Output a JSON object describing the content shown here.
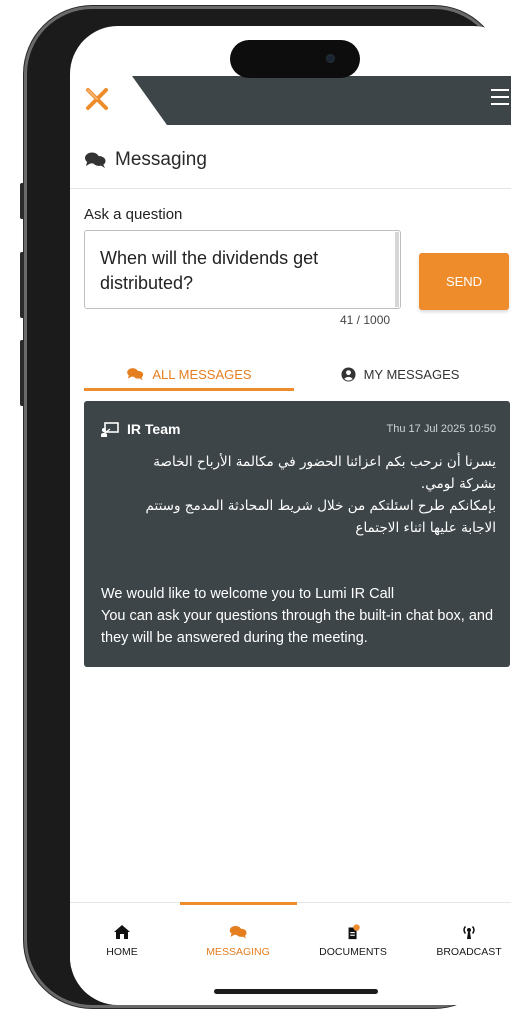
{
  "header": {
    "logo_icon": "x-logo-icon",
    "menu_icon": "hamburger-icon",
    "band_color": "#3d4548",
    "accent": "#ee8c2b"
  },
  "messaging": {
    "title": "Messaging",
    "title_icon": "chat-bubbles-icon",
    "ask_label": "Ask a question",
    "question_value": "When will the dividends get distributed?",
    "send_label": "SEND",
    "counter": "41 / 1000"
  },
  "tabs": [
    {
      "label": "ALL MESSAGES",
      "icon": "chat-bubbles-icon",
      "active": true
    },
    {
      "label": "MY MESSAGES",
      "icon": "user-circle-icon",
      "active": false
    }
  ],
  "message": {
    "sender": "IR Team",
    "sender_icon": "presenter-icon",
    "timestamp": "Thu 17 Jul 2025 10:50",
    "arabic_text": "يسرنا أن نرحب بكم اعزائنا الحضور في مكالمة الأرباح الخاصة\nبشركة لومي.\nبإمكانكم طرح اسئلتكم  من خلال شريط المحادثة المدمج وستتم\nالاجابة عليها اثناء الاجتماع",
    "english_text": "We would like to welcome you to Lumi IR Call\nYou can ask your questions through the built-in chat box, and they will be answered during the meeting."
  },
  "bottom_nav": [
    {
      "label": "HOME",
      "icon": "home-icon",
      "active": false
    },
    {
      "label": "MESSAGING",
      "icon": "chat-bubbles-icon",
      "active": true
    },
    {
      "label": "DOCUMENTS",
      "icon": "document-icon",
      "active": false
    },
    {
      "label": "BROADCAST",
      "icon": "broadcast-icon",
      "active": false
    }
  ]
}
